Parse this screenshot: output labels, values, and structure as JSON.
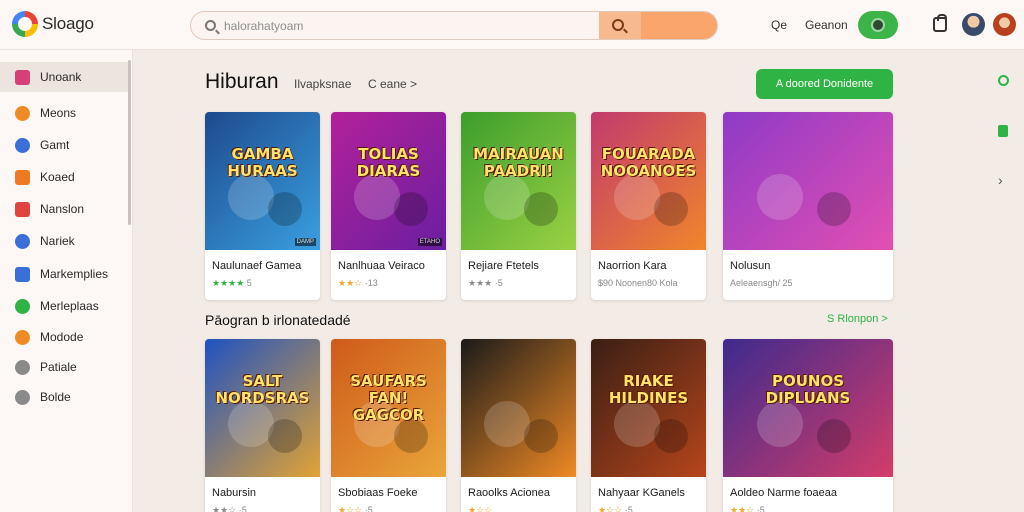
{
  "app": {
    "logo_text": "Sloago"
  },
  "search": {
    "placeholder": "halorahatyoam"
  },
  "topbar": {
    "link_1": "Qe",
    "link_2": "Geanon"
  },
  "sidebar": {
    "items": [
      {
        "label": "Unoank",
        "icon": "bookmark-icon",
        "color": "#d64078",
        "active": true
      },
      {
        "label": "Meons",
        "icon": "circle-icon",
        "color": "#f08a24"
      },
      {
        "label": "Gamt",
        "icon": "coin-icon",
        "color": "#3b6fd8"
      },
      {
        "label": "Koaed",
        "icon": "square-icon",
        "color": "#f07a24"
      },
      {
        "label": "Nanslon",
        "icon": "square-icon",
        "color": "#e0443e"
      },
      {
        "label": "Nariek",
        "icon": "figure-icon",
        "color": "#3b6fd8"
      },
      {
        "label": "Markemplies",
        "icon": "grid-icon",
        "color": "#3b6fd8"
      },
      {
        "label": "Merleplaas",
        "icon": "circle-icon",
        "color": "#2fb344"
      },
      {
        "label": "Modode",
        "icon": "circle-icon",
        "color": "#f08a24"
      },
      {
        "label": "Patiale",
        "icon": "wrench-icon",
        "color": "#8a8a8a"
      },
      {
        "label": "Bolde",
        "icon": "circle-icon",
        "color": "#8a8a8a"
      }
    ]
  },
  "main": {
    "title": "Hiburan",
    "tabs": [
      "Ilvapksnae",
      "C eane >"
    ],
    "cta_label": "A doored Donidente",
    "section2_title": "Pāogran b irlonatedadé",
    "section2_link": "S Rlonpon >",
    "row1": [
      {
        "title": "Naulunaef Gamea",
        "stars": "★★★★",
        "meta": "5",
        "star_color": "green",
        "art_text": "GAMBA HURAAS",
        "palette": [
          "#1d4a8e",
          "#3aa0e0"
        ],
        "tag": "DAMP"
      },
      {
        "title": "Nanlhuaa Veiraco",
        "stars": "★★☆",
        "meta": "·13",
        "star_color": "orange",
        "art_text": "TOLIAS DIARAS",
        "palette": [
          "#b3209a",
          "#6a1fa0"
        ],
        "tag": "ETAHO"
      },
      {
        "title": "Rejiare Ftetels",
        "stars": "★★★",
        "meta": "·5",
        "star_color": "grey",
        "art_text": "MAIRAUAN PAADRI!",
        "palette": [
          "#3c9e2c",
          "#9bd144"
        ]
      },
      {
        "title": "Naorrion Kara",
        "stars": "",
        "meta": "$90 Noonen80 Kola",
        "star_color": "grey",
        "art_text": "FOUARADA NOOANOES",
        "palette": [
          "#c23a6e",
          "#f0862a"
        ]
      },
      {
        "title": "Nolusun",
        "stars": "",
        "meta": "Aeleaensgh/ 25",
        "star_color": "grey",
        "art_text": "",
        "palette": [
          "#8e3ac7",
          "#e24fb2"
        ]
      }
    ],
    "row2": [
      {
        "title": "Nabursin",
        "stars": "★★☆",
        "meta": "·5",
        "star_color": "grey",
        "art_text": "SALT NORDSRAS",
        "palette": [
          "#1f52c2",
          "#e2a333"
        ]
      },
      {
        "title": "Sbobiaas Foeke",
        "stars": "★☆☆",
        "meta": "·5",
        "star_color": "orange",
        "art_text": "SAUFARS FAN! GAGCOR",
        "palette": [
          "#cf5a1a",
          "#e9a63a"
        ]
      },
      {
        "title": "Raoolks Acionea",
        "stars": "★☆☆",
        "meta": "",
        "star_color": "orange",
        "art_text": "",
        "palette": [
          "#1a1a1a",
          "#f08a24"
        ]
      },
      {
        "title": "Nahyaar KGanels",
        "stars": "★☆☆",
        "meta": "·5",
        "star_color": "orange",
        "art_text": "RIAKE HILDINES",
        "palette": [
          "#3a1f14",
          "#b6451c"
        ]
      },
      {
        "title": "Aoldeo Narme foaeaa",
        "stars": "★★☆",
        "meta": "·5",
        "star_color": "orange",
        "art_text": "POUNOS DIPLUANS",
        "palette": [
          "#3d2a8e",
          "#d43c6a"
        ]
      }
    ]
  }
}
